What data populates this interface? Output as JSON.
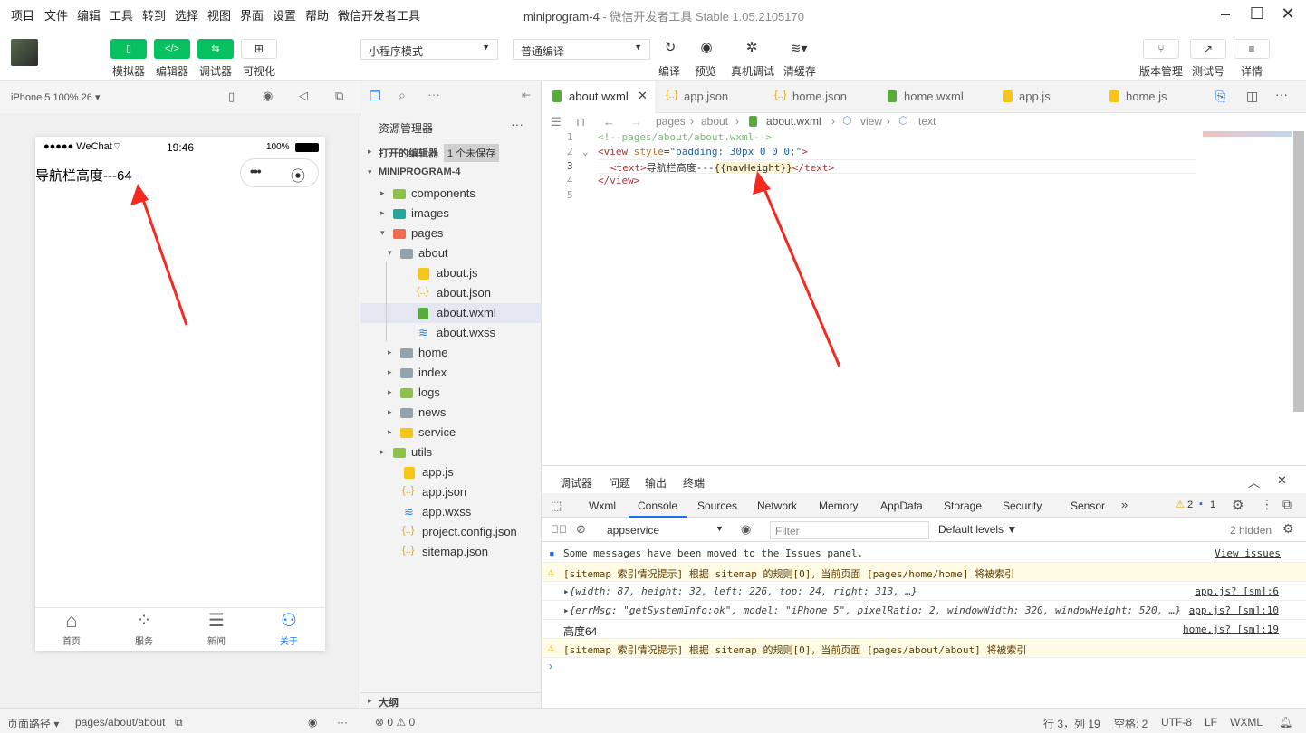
{
  "menu": [
    "项目",
    "文件",
    "编辑",
    "工具",
    "转到",
    "选择",
    "视图",
    "界面",
    "设置",
    "帮助",
    "微信开发者工具"
  ],
  "window": {
    "title": "miniprogram-4",
    "subtitle": " - 微信开发者工具 Stable 1.05.2105170"
  },
  "toolbar": {
    "simulator": "模拟器",
    "editor": "编辑器",
    "debugger": "调试器",
    "visual": "可视化",
    "mode": "小程序模式",
    "compile_mode": "普通编译",
    "compile": "编译",
    "preview": "预览",
    "real_debug": "真机调试",
    "clear_cache": "清缓存",
    "version": "版本管理",
    "test": "测试号",
    "details": "详情"
  },
  "simulator": {
    "device": "iPhone 5 100% 26 ▾",
    "carrier": "●●●●● WeChat",
    "time": "19:46",
    "battery": "100%",
    "content_text": "导航栏高度---64",
    "tabbar": [
      {
        "label": "首页"
      },
      {
        "label": "服务"
      },
      {
        "label": "新闻"
      },
      {
        "label": "关于"
      }
    ],
    "accent": "#1677ff"
  },
  "explorer": {
    "title": "资源管理器",
    "open_editors": "打开的编辑器",
    "unsaved": "1 个未保存",
    "project": "MINIPROGRAM-4",
    "outline": "大纲",
    "items": [
      "components",
      "images",
      "pages",
      "about",
      "about.js",
      "about.json",
      "about.wxml",
      "about.wxss",
      "home",
      "index",
      "logs",
      "news",
      "service",
      "utils",
      "app.js",
      "app.json",
      "app.wxss",
      "project.config.json",
      "sitemap.json"
    ]
  },
  "editor": {
    "tabs": [
      "about.wxml",
      "app.json",
      "home.json",
      "home.wxml",
      "app.js",
      "home.js"
    ],
    "breadcrumb": [
      "pages",
      "about",
      "about.wxml",
      "view",
      "text"
    ],
    "lines": [
      "1",
      "2",
      "3",
      "4",
      "5"
    ],
    "code": {
      "l1": "<!--pages/about/about.wxml-->",
      "l2a": "<view ",
      "l2b": "style",
      "l2c": "=",
      "l2d": "\"padding: 30px 0 0 0;\"",
      "l2e": ">",
      "l3a": "<text>",
      "l3b": "导航栏高度---",
      "l3c": "{{navHeight}}",
      "l3d": "</text>",
      "l4": "</view>"
    }
  },
  "debug": {
    "tabs": [
      "调试器",
      "问题",
      "输出",
      "终端"
    ],
    "devtabs": [
      "Wxml",
      "Console",
      "Sources",
      "Network",
      "Memory",
      "AppData",
      "Storage",
      "Security",
      "Sensor"
    ],
    "warn_count": "2",
    "info_count": "1",
    "context": "appservice",
    "filter": "Filter",
    "levels": "Default levels ▼",
    "hidden": "2 hidden",
    "messages": [
      {
        "text": "Some messages have been moved to the Issues panel.",
        "src": "View issues"
      },
      {
        "text": "[sitemap 索引情况提示] 根据 sitemap 的规则[0]，当前页面 [pages/home/home] 将被索引",
        "src": ""
      },
      {
        "text": "▸{width: 87, height: 32, left: 226, top: 24, right: 313, …}",
        "src": "app.js? [sm]:6"
      },
      {
        "text": "▸{errMsg: \"getSystemInfo:ok\", model: \"iPhone 5\", pixelRatio: 2, windowWidth: 320, windowHeight: 520, …}",
        "src": "app.js? [sm]:10"
      },
      {
        "text": "高度64",
        "src": "home.js? [sm]:19"
      },
      {
        "text": "[sitemap 索引情况提示] 根据 sitemap 的规则[0]，当前页面 [pages/about/about] 将被索引",
        "src": ""
      }
    ]
  },
  "status": {
    "page_path_label": "页面路径 ▾",
    "page_path": "pages/about/about",
    "errors": "⊗ 0 ⚠ 0",
    "position": "行 3，列 19",
    "spaces": "空格: 2",
    "encoding": "UTF-8",
    "eol": "LF",
    "lang": "WXML"
  }
}
